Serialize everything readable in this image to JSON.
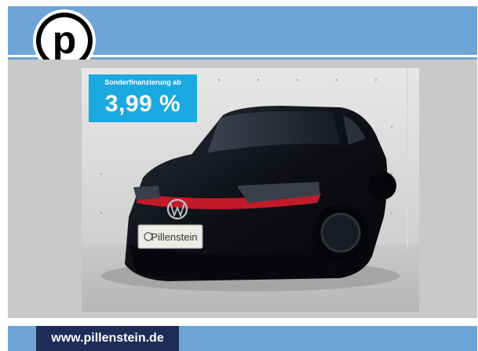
{
  "logo": {
    "letter": "p",
    "icon": "pillenstein-p-logo"
  },
  "promo": {
    "title": "Sonderfinanzierung ab",
    "rate": "3,99 %"
  },
  "car": {
    "plate_text": "Pillenstein"
  },
  "footer": {
    "url": "www.pillenstein.de"
  },
  "colors": {
    "band": "#6fa5d6",
    "promo": "#1ba9e2",
    "footer_box": "#1e2c58",
    "car_body": "#0e1016",
    "gti_red": "#c31a2a"
  }
}
